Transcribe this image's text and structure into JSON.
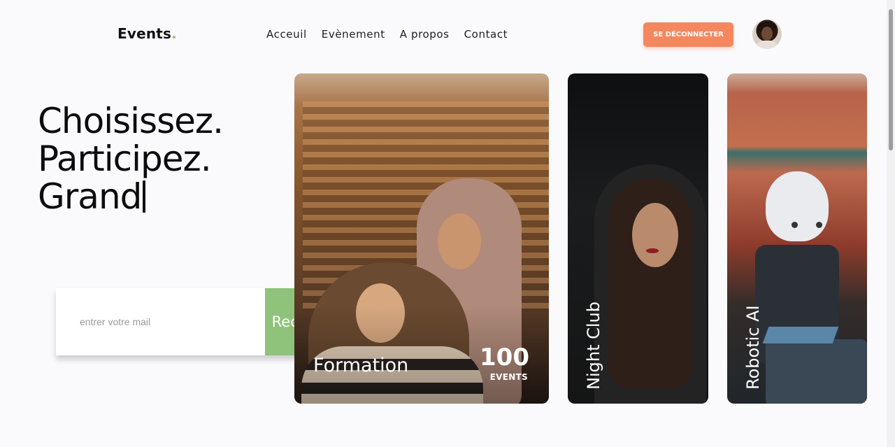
{
  "header": {
    "logo_text": "Events",
    "logo_dot": ".",
    "nav": [
      "Acceuil",
      "Evènement",
      "A propos",
      "Contact"
    ],
    "logout_label": "SE DÉCONNECTER"
  },
  "hero": {
    "lines": [
      "Choisissez.",
      "Participez.",
      "Grand"
    ]
  },
  "subscribe": {
    "placeholder": "entrer votre mail",
    "button_label": "Recevoir"
  },
  "cards": [
    {
      "label": "Formation",
      "count": "100",
      "count_label": "EVENTS"
    },
    {
      "label": "Night Club"
    },
    {
      "label": "Robotic AI"
    }
  ],
  "colors": {
    "accent_orange": "#f5875e",
    "accent_green": "#8fc27a"
  }
}
